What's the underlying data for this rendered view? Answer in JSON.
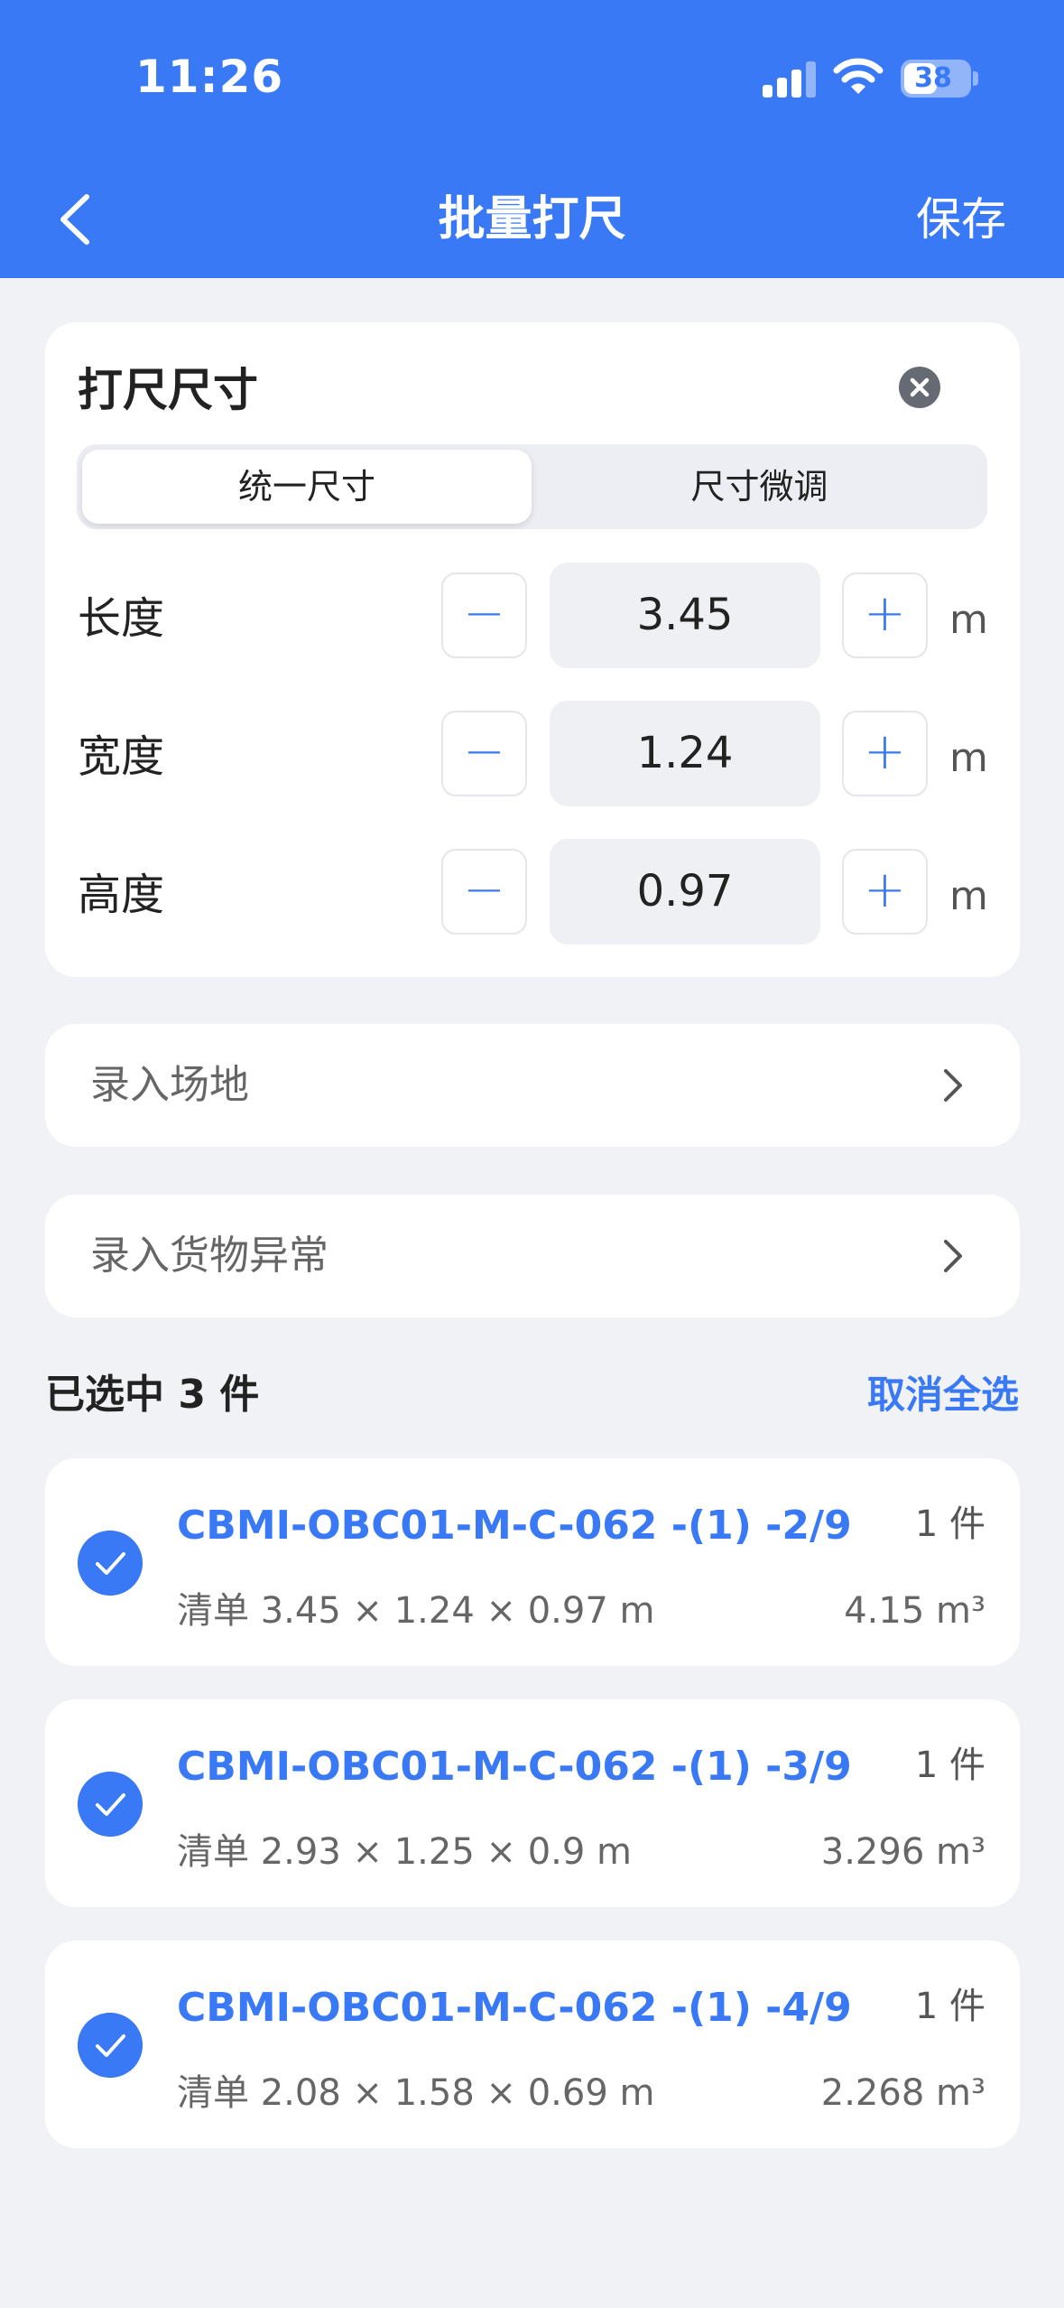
{
  "status_bar": {
    "time": "11:26",
    "battery": "38"
  },
  "nav": {
    "title": "批量打尺",
    "save_label": "保存"
  },
  "size_card": {
    "title": "打尺尺寸",
    "tabs": [
      {
        "label": "统一尺寸",
        "active": true
      },
      {
        "label": "尺寸微调",
        "active": false
      }
    ],
    "dimensions": [
      {
        "label": "长度",
        "value": "3.45",
        "unit": "m",
        "minus": "−",
        "plus": "+"
      },
      {
        "label": "宽度",
        "value": "1.24",
        "unit": "m",
        "minus": "−",
        "plus": "+"
      },
      {
        "label": "高度",
        "value": "0.97",
        "unit": "m",
        "minus": "−",
        "plus": "+"
      }
    ]
  },
  "rows": {
    "site": "录入场地",
    "anomaly": "录入货物异常"
  },
  "selection": {
    "summary": "已选中 3 件",
    "deselect_label": "取消全选"
  },
  "items": [
    {
      "code": "CBMI-OBC01-M-C-062 -(1) -2/9",
      "qty": "1 件",
      "dims": "清单 3.45 × 1.24 × 0.97 m",
      "volume": "4.15 m³",
      "checked": true
    },
    {
      "code": "CBMI-OBC01-M-C-062 -(1) -3/9",
      "qty": "1 件",
      "dims": "清单 2.93 × 1.25 × 0.9 m",
      "volume": "3.296 m³",
      "checked": true
    },
    {
      "code": "CBMI-OBC01-M-C-062 -(1) -4/9",
      "qty": "1 件",
      "dims": "清单 2.08 × 1.58 × 0.69 m",
      "volume": "2.268 m³",
      "checked": true
    }
  ],
  "colors": {
    "accent": "#3a79f5",
    "background": "#f1f2f6"
  }
}
